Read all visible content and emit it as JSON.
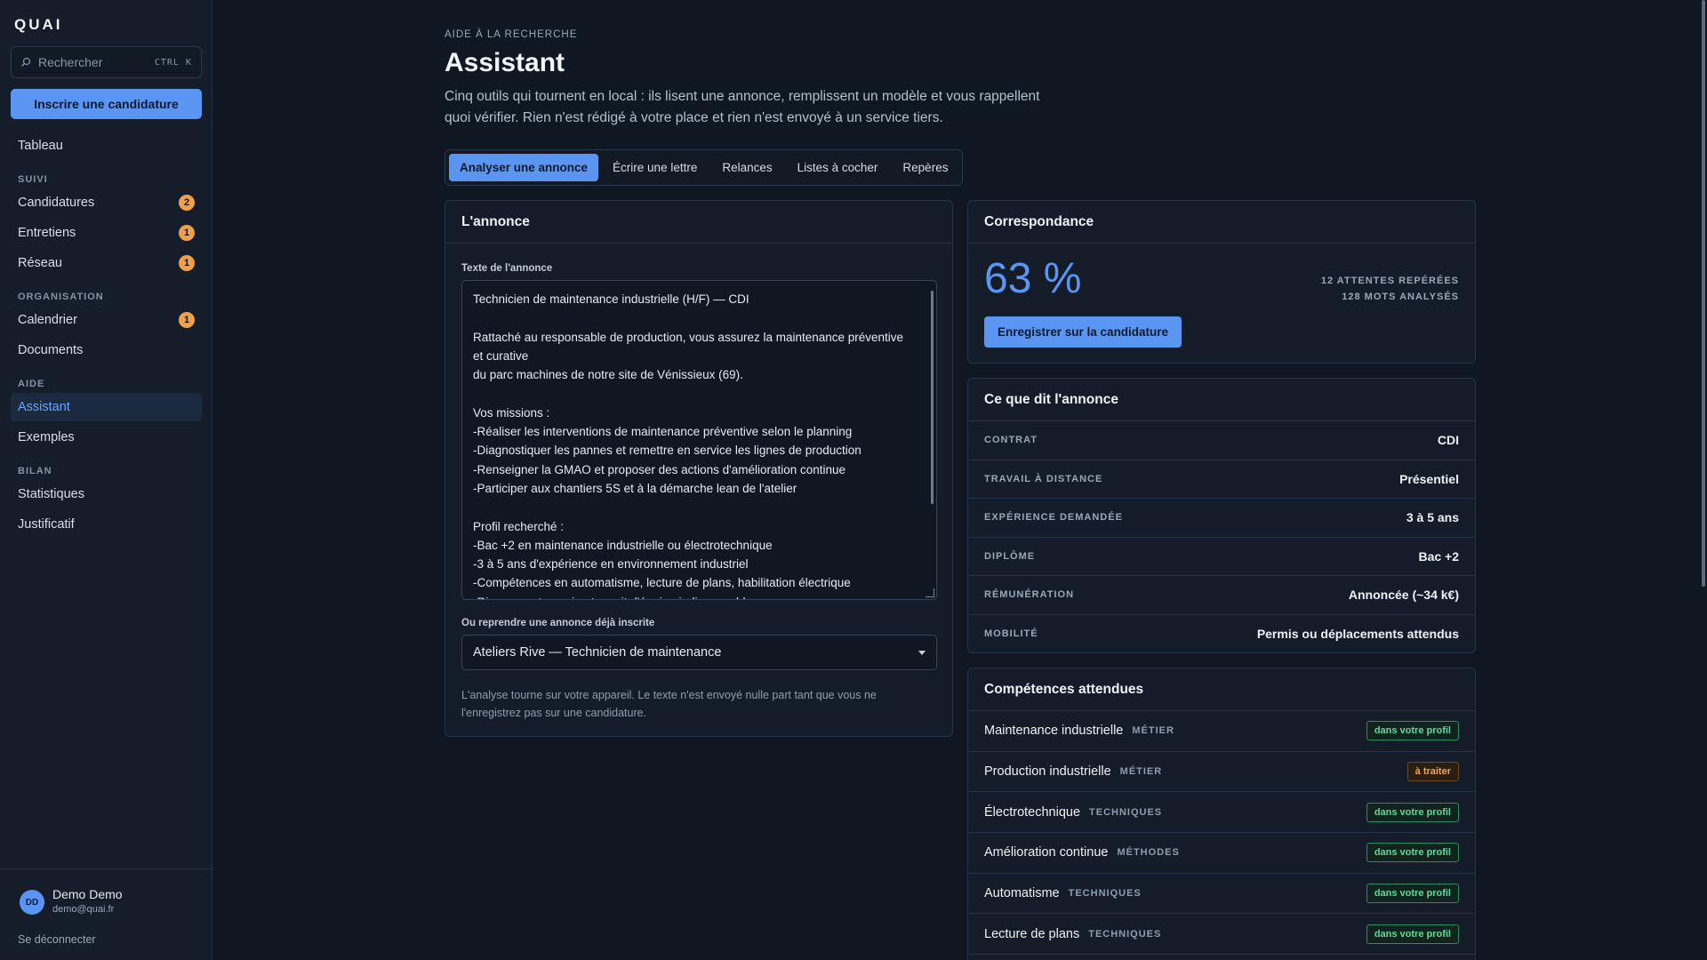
{
  "app": {
    "brand": "QUAI"
  },
  "sidebar": {
    "search_placeholder": "Rechercher",
    "search_shortcut": "CTRL K",
    "primary_action": "Inscrire une candidature",
    "top_item": "Tableau",
    "sections": [
      {
        "title": "SUIVI",
        "items": [
          {
            "label": "Candidatures",
            "badge": "2"
          },
          {
            "label": "Entretiens",
            "badge": "1"
          },
          {
            "label": "Réseau",
            "badge": "1"
          }
        ]
      },
      {
        "title": "ORGANISATION",
        "items": [
          {
            "label": "Calendrier",
            "badge": "1"
          },
          {
            "label": "Documents",
            "badge": ""
          }
        ]
      },
      {
        "title": "AIDE",
        "items": [
          {
            "label": "Assistant",
            "badge": "",
            "active": true
          },
          {
            "label": "Exemples",
            "badge": ""
          }
        ]
      },
      {
        "title": "BILAN",
        "items": [
          {
            "label": "Statistiques",
            "badge": ""
          },
          {
            "label": "Justificatif",
            "badge": ""
          }
        ]
      }
    ],
    "user": {
      "initials": "DD",
      "name": "Demo Demo",
      "email": "demo@quai.fr"
    },
    "logout": "Se déconnecter"
  },
  "header": {
    "eyebrow": "AIDE À LA RECHERCHE",
    "title": "Assistant",
    "lead": "Cinq outils qui tournent en local : ils lisent une annonce, remplissent un modèle et vous rappellent quoi vérifier. Rien n'est rédigé à votre place et rien n'est envoyé à un service tiers."
  },
  "tabs": [
    "Analyser une annonce",
    "Écrire une lettre",
    "Relances",
    "Listes à cocher",
    "Repères"
  ],
  "annonce": {
    "title": "L'annonce",
    "text_label": "Texte de l'annonce",
    "text": "Technicien de maintenance industrielle (H/F) — CDI\n\nRattaché au responsable de production, vous assurez la maintenance préventive et curative\ndu parc machines de notre site de Vénissieux (69).\n\nVos missions :\n-Réaliser les interventions de maintenance préventive selon le planning\n-Diagnostiquer les pannes et remettre en service les lignes de production\n-Renseigner la GMAO et proposer des actions d'amélioration continue\n-Participer aux chantiers 5S et à la démarche lean de l'atelier\n\nProfil recherché :\n-Bac +2 en maintenance industrielle ou électrotechnique\n-3 à 5 ans d'expérience en environnement industriel\n-Compétences en automatisme, lecture de plans, habilitation électrique\n-Rigueur, autonomie et esprit d'équipe indispensables",
    "select_label": "Ou reprendre une annonce déjà inscrite",
    "select_value": "Ateliers Rive — Technicien de maintenance",
    "note": "L'analyse tourne sur votre appareil. Le texte n'est envoyé nulle part tant que vous ne l'enregistrez pas sur une candidature."
  },
  "correspondance": {
    "title": "Correspondance",
    "score": "63 %",
    "score_value": 63,
    "meta1": "12 ATTENTES REPÉRÉES",
    "meta2": "128 MOTS ANALYSÉS",
    "save_label": "Enregistrer sur la candidature"
  },
  "dit": {
    "title": "Ce que dit l'annonce",
    "rows": [
      {
        "key": "CONTRAT",
        "value": "CDI"
      },
      {
        "key": "TRAVAIL À DISTANCE",
        "value": "Présentiel"
      },
      {
        "key": "EXPÉRIENCE DEMANDÉE",
        "value": "3 à 5 ans"
      },
      {
        "key": "DIPLÔME",
        "value": "Bac +2"
      },
      {
        "key": "RÉMUNÉRATION",
        "value": "Annoncée (~34 k€)"
      },
      {
        "key": "MOBILITÉ",
        "value": "Permis ou déplacements attendus"
      }
    ]
  },
  "competences": {
    "title": "Compétences attendues",
    "rows": [
      {
        "name": "Maintenance industrielle",
        "category": "MÉTIER",
        "status": "dans votre profil",
        "kind": "ok"
      },
      {
        "name": "Production industrielle",
        "category": "MÉTIER",
        "status": "à traiter",
        "kind": "todo"
      },
      {
        "name": "Électrotechnique",
        "category": "TECHNIQUES",
        "status": "dans votre profil",
        "kind": "ok"
      },
      {
        "name": "Amélioration continue",
        "category": "MÉTHODES",
        "status": "dans votre profil",
        "kind": "ok"
      },
      {
        "name": "Automatisme",
        "category": "TECHNIQUES",
        "status": "dans votre profil",
        "kind": "ok"
      },
      {
        "name": "Lecture de plans",
        "category": "TECHNIQUES",
        "status": "dans votre profil",
        "kind": "ok"
      }
    ]
  },
  "colors": {
    "accent": "#5b95f2",
    "badge": "#f0a04b",
    "ok": "#5fd7a0",
    "todo": "#f2a552"
  }
}
